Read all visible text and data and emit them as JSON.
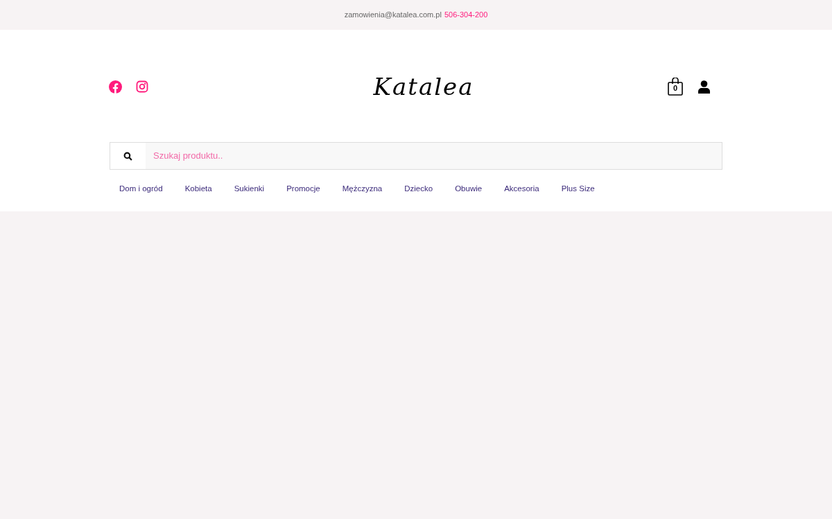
{
  "top_bar": {
    "email": "zamowienia@katalea.com.pl",
    "phone": "506-304-200"
  },
  "header": {
    "logo": "Katalea",
    "cart_count": "0"
  },
  "search": {
    "placeholder": "Szukaj produktu.."
  },
  "menu": [
    "Dom i ogród",
    "Kobieta",
    "Sukienki",
    "Promocje",
    "Mężczyzna",
    "Dziecko",
    "Obuwie",
    "Akcesoria",
    "Plus Size"
  ]
}
